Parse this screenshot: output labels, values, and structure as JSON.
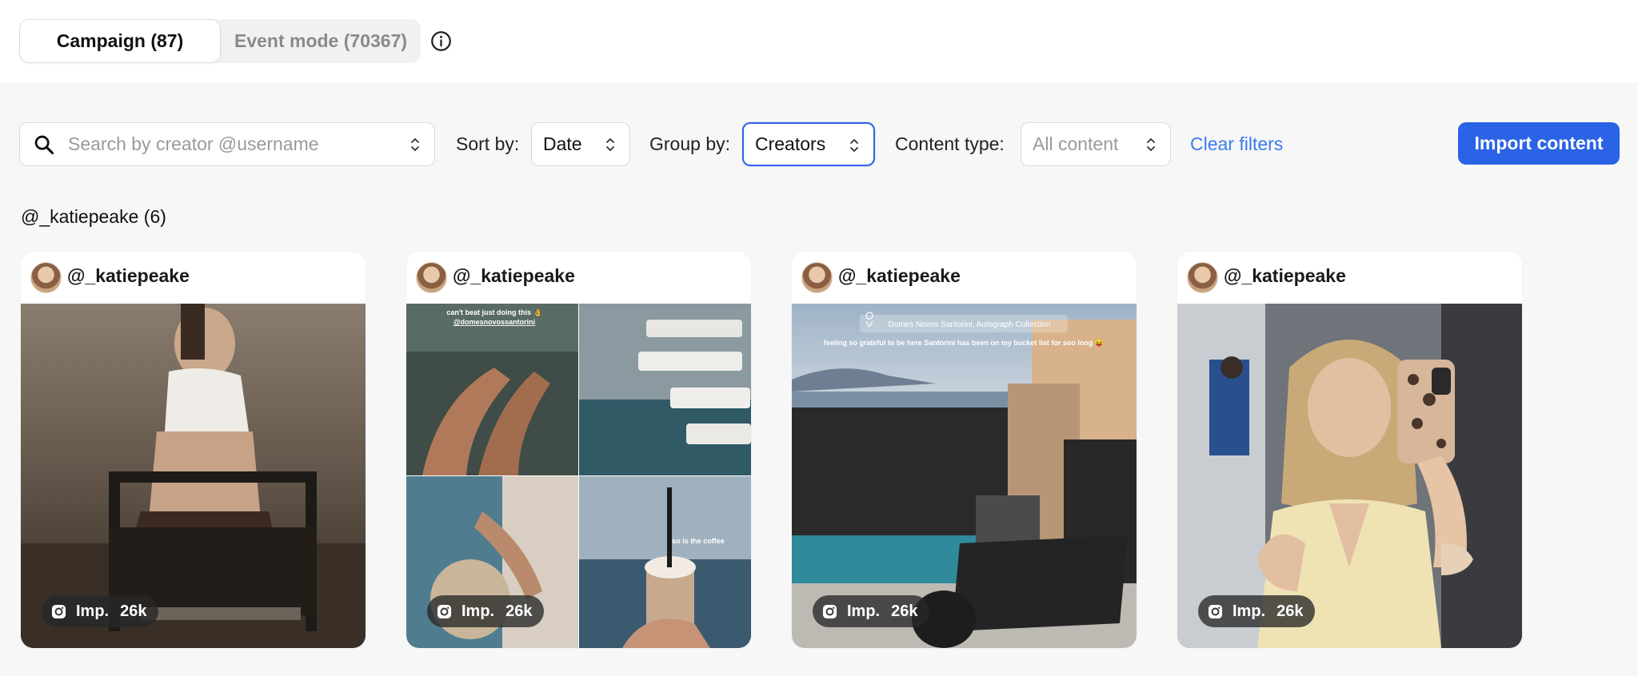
{
  "tabs": {
    "campaign": "Campaign (87)",
    "event_mode": "Event mode (70367)"
  },
  "filters": {
    "search_placeholder": "Search by creator @username",
    "sort_label": "Sort by:",
    "sort_value": "Date",
    "group_label": "Group by:",
    "group_value": "Creators",
    "content_type_label": "Content type:",
    "content_type_value": "All content",
    "clear_filters": "Clear filters",
    "import_button": "Import content"
  },
  "group": {
    "title": "@_katiepeake (6)"
  },
  "cards": [
    {
      "username": "@_katiepeake",
      "imp_label": "Imp.",
      "imp_value": "26k",
      "media": "photo"
    },
    {
      "username": "@_katiepeake",
      "imp_label": "Imp.",
      "imp_value": "26k",
      "media": "collage",
      "collage_text": {
        "top": "can't beat just doing this 👌",
        "handle": "@domesnovossantorini",
        "coffee": "so is the coffee"
      }
    },
    {
      "username": "@_katiepeake",
      "imp_label": "Imp.",
      "imp_value": "26k",
      "media": "photo",
      "overlay": {
        "location": "Domes Novos Santorini, Autograph Collection",
        "caption": "feeling so grateful to be here Santorini has been on my bucket list for soo long 😝"
      }
    },
    {
      "username": "@_katiepeake",
      "imp_label": "Imp.",
      "imp_value": "26k",
      "media": "photo"
    }
  ],
  "colors": {
    "accent": "#2a63e6",
    "link": "#3b7bf0",
    "background": "#f7f7f7"
  },
  "icons": [
    "info-icon",
    "search-icon",
    "chevron-updown-icon",
    "instagram-icon",
    "location-pin-icon"
  ]
}
